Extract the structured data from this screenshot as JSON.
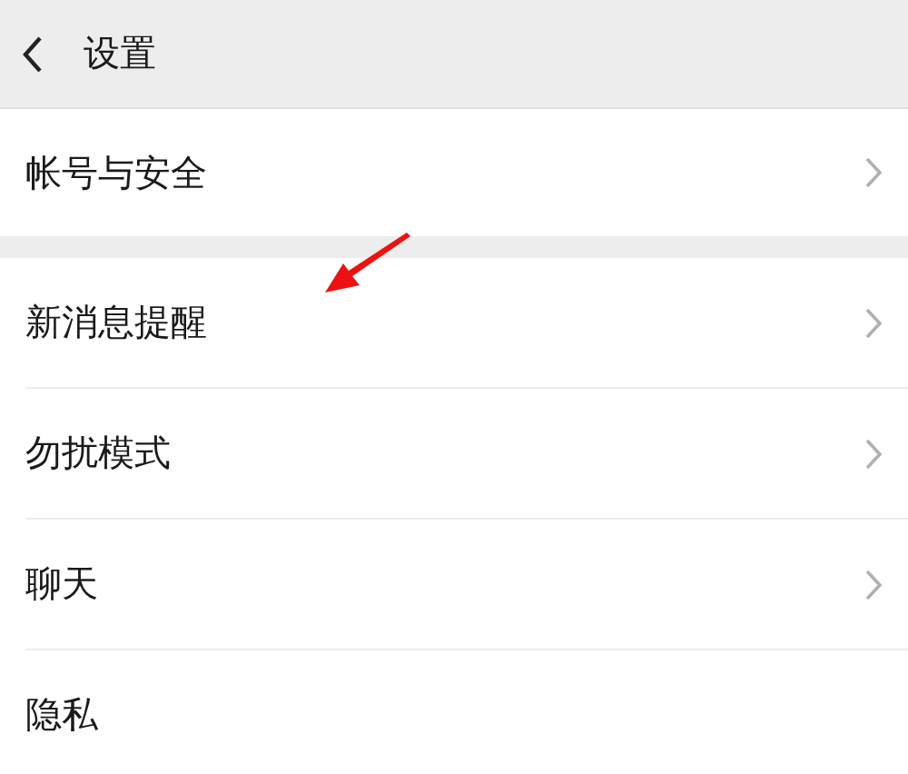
{
  "header": {
    "title": "设置"
  },
  "groups": [
    {
      "items": [
        {
          "label": "帐号与安全",
          "chevron": true
        }
      ]
    },
    {
      "items": [
        {
          "label": "新消息提醒",
          "chevron": true
        },
        {
          "label": "勿扰模式",
          "chevron": true
        },
        {
          "label": "聊天",
          "chevron": true
        },
        {
          "label": "隐私",
          "chevron": false
        }
      ]
    }
  ]
}
